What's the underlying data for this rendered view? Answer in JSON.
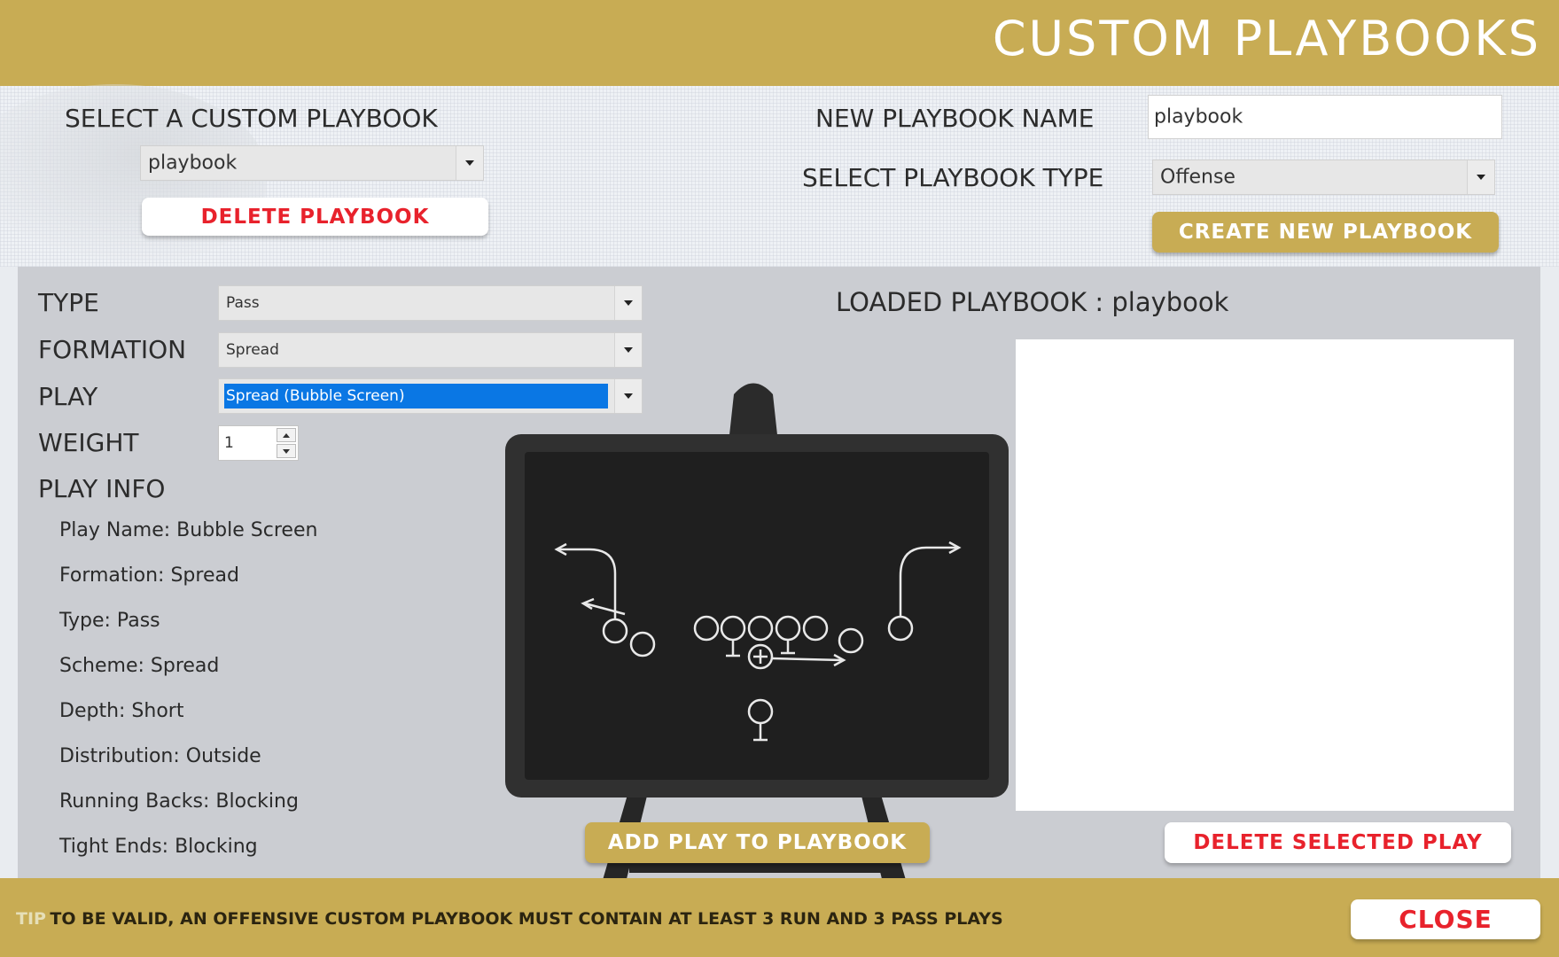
{
  "header": {
    "title": "CUSTOM PLAYBOOKS"
  },
  "select_playbook": {
    "label": "SELECT A CUSTOM PLAYBOOK",
    "selected": "playbook",
    "delete_label": "DELETE PLAYBOOK"
  },
  "new_playbook": {
    "name_label": "NEW PLAYBOOK NAME",
    "name_value": "playbook",
    "type_label": "SELECT PLAYBOOK TYPE",
    "type_value": "Offense",
    "create_label": "CREATE NEW PLAYBOOK"
  },
  "form": {
    "type_label": "TYPE",
    "type_value": "Pass",
    "formation_label": "FORMATION",
    "formation_value": "Spread",
    "play_label": "PLAY",
    "play_value": "Spread (Bubble Screen)",
    "weight_label": "WEIGHT",
    "weight_value": "1"
  },
  "play_info": {
    "heading": "PLAY INFO",
    "lines": [
      "Play Name: Bubble Screen",
      "Formation: Spread",
      "Type: Pass",
      "Scheme: Spread",
      "Depth: Short",
      "Distribution: Outside",
      "Running Backs: Blocking",
      "Tight Ends: Blocking"
    ]
  },
  "loaded": {
    "label": "LOADED PLAYBOOK :",
    "value": "playbook"
  },
  "buttons": {
    "add_play": "ADD PLAY TO PLAYBOOK",
    "delete_selected": "DELETE SELECTED PLAY",
    "close": "CLOSE"
  },
  "tip": {
    "prefix": "TIP",
    "text": "TO BE VALID, AN OFFENSIVE CUSTOM PLAYBOOK MUST CONTAIN AT LEAST 3 RUN AND 3 PASS PLAYS"
  },
  "colors": {
    "gold": "#c8ac54",
    "danger_text": "#e8222c",
    "selection_blue": "#0a77e4",
    "chalkboard": "#2a2a2a"
  }
}
